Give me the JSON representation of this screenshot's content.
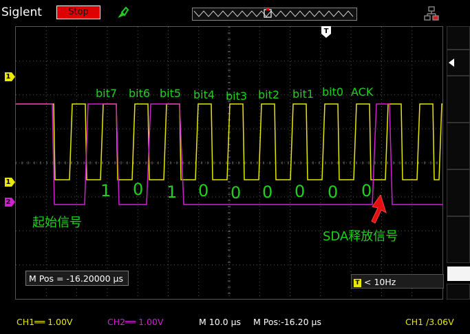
{
  "topbar": {
    "brand": "Siglent",
    "run_state": "Stop",
    "probe_icon": "probe-icon",
    "network_icon": "network-icon"
  },
  "trigger_marker": "T",
  "markers": {
    "ch1_level": "1",
    "ch1_offset": "1",
    "ch2_offset": "2",
    "trigger_box": "T"
  },
  "annotations": {
    "bit_labels": [
      "bit7",
      "bit6",
      "bit5",
      "bit4",
      "bit3",
      "bit2",
      "bit1",
      "bit0",
      "ACK"
    ],
    "bit_values": [
      "1",
      "0",
      "1",
      "0",
      "0",
      "0",
      "0",
      "0",
      "0"
    ],
    "start_signal": "起始信号",
    "sda_release": "SDA释放信号"
  },
  "mpos_box": "M Pos = -16.20000 µs",
  "trigger_freq": "< 10Hz",
  "status": {
    "ch1": "CH1══ 1.00V",
    "ch2": "CH2══ 1.00V",
    "timebase": "M 10.0 µs",
    "mpos": "M Pos:-16.20 µs",
    "trigger": "CH1 ∕3.06V"
  },
  "colors": {
    "ch1": "#e8e800",
    "ch2": "#d020d0",
    "annotation": "#1fd11f",
    "stop": "#e00000"
  }
}
